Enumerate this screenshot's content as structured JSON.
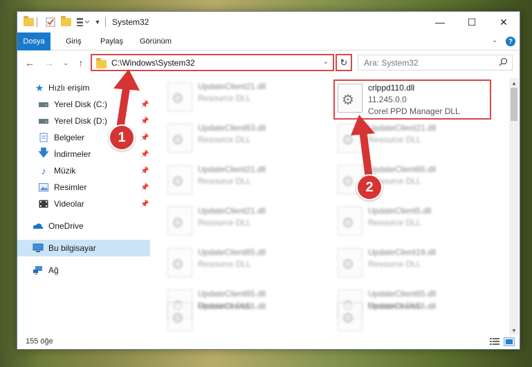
{
  "window": {
    "title": "System32",
    "minimize": "—",
    "maximize": "☐",
    "close": "✕"
  },
  "ribbon": {
    "tabs": [
      "Dosya",
      "Giriş",
      "Paylaş",
      "Görünüm"
    ],
    "help": "?"
  },
  "address": {
    "path": "C:\\Windows\\System32",
    "search_placeholder": "Ara: System32"
  },
  "nav_pane": {
    "quick_access": "Hızlı erişim",
    "items": [
      {
        "label": "Yerel Disk (C:)",
        "icon": "drive-icon",
        "pinned": true
      },
      {
        "label": "Yerel Disk (D:)",
        "icon": "drive-icon",
        "pinned": true
      },
      {
        "label": "Belgeler",
        "icon": "documents-icon",
        "pinned": true
      },
      {
        "label": "İndirmeler",
        "icon": "download-icon",
        "pinned": true
      },
      {
        "label": "Müzik",
        "icon": "music-icon",
        "pinned": true
      },
      {
        "label": "Resimler",
        "icon": "pictures-icon",
        "pinned": true
      },
      {
        "label": "Videolar",
        "icon": "videos-icon",
        "pinned": true
      }
    ],
    "onedrive": "OneDrive",
    "this_pc": "Bu bilgisayar",
    "network": "Ağ"
  },
  "files": {
    "left_column": [
      {
        "name": "UpdateClient21.dll",
        "desc": "Resource DLL"
      },
      {
        "name": "UpdateClient63.dll",
        "desc": "Resource DLL"
      },
      {
        "name": "UpdateClient21.dll",
        "desc": "Resource DLL"
      },
      {
        "name": "UpdateClient21.dll",
        "desc": "Resource DLL"
      },
      {
        "name": "UpdateClient65.dll",
        "desc": "Resource DLL"
      },
      {
        "name": "UpdateClient65.dll",
        "desc": "Resource DLL"
      },
      {
        "name": "UpdateClient65.dll",
        "desc": ""
      }
    ],
    "highlighted": {
      "name": "crlppd110.dll",
      "version": "11.245.0.0",
      "desc": "Corel PPD Manager DLL"
    },
    "right_column": [
      {
        "name": "UpdateClient21.dll",
        "desc": "Resource DLL"
      },
      {
        "name": "UpdateClient65.dll",
        "desc": "Resource DLL"
      },
      {
        "name": "UpdateClient5.dll",
        "desc": "Resource DLL"
      },
      {
        "name": "UpdateClient19.dll",
        "desc": "Resource DLL"
      },
      {
        "name": "UpdateClient65.dll",
        "desc": "Resource DLL"
      },
      {
        "name": "UpdateClient65.dll",
        "desc": ""
      }
    ]
  },
  "status": {
    "count": "155 öğe"
  },
  "annotations": {
    "step1": "1",
    "step2": "2"
  },
  "colors": {
    "accent": "#1979ca",
    "highlight_border": "#d64848",
    "annotation": "#d63434",
    "selected_nav": "#cce4f7"
  }
}
